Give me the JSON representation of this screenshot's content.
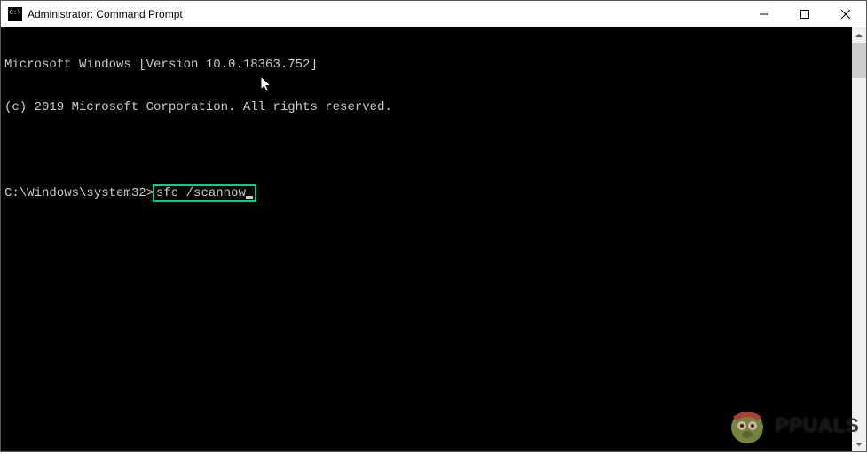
{
  "titlebar": {
    "title": "Administrator: Command Prompt",
    "icon_glyph": "C:\\"
  },
  "terminal": {
    "line1": "Microsoft Windows [Version 10.0.18363.752]",
    "line2": "(c) 2019 Microsoft Corporation. All rights reserved.",
    "prompt": "C:\\Windows\\system32>",
    "command": "sfc /scannow"
  },
  "watermark": {
    "text": "PPUALS"
  }
}
